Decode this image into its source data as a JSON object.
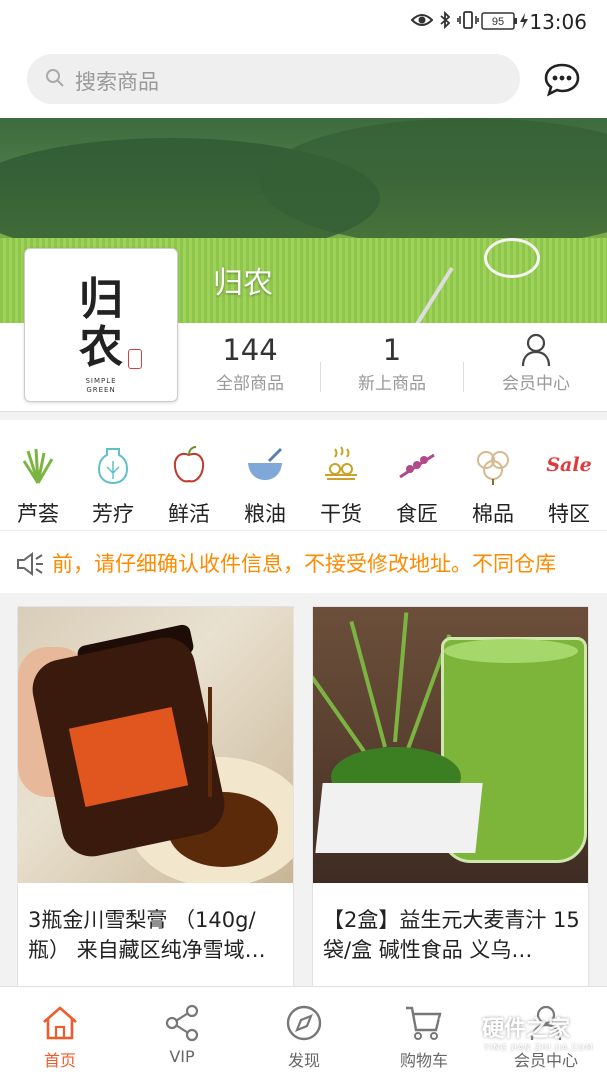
{
  "status_bar": {
    "battery": "95",
    "time": "13:06"
  },
  "search": {
    "placeholder": "搜索商品"
  },
  "store": {
    "name": "归农",
    "logo_text": [
      "归",
      "农"
    ],
    "logo_sub": [
      "SIMPLE",
      "GREEN"
    ],
    "stats": [
      {
        "value": "144",
        "label": "全部商品"
      },
      {
        "value": "1",
        "label": "新上商品"
      },
      {
        "value": "",
        "label": "会员中心"
      }
    ]
  },
  "categories": [
    {
      "label": "芦荟",
      "icon": "aloe-icon"
    },
    {
      "label": "芳疗",
      "icon": "aroma-icon"
    },
    {
      "label": "鲜活",
      "icon": "fresh-icon"
    },
    {
      "label": "粮油",
      "icon": "grain-oil-icon"
    },
    {
      "label": "干货",
      "icon": "dried-goods-icon"
    },
    {
      "label": "食匠",
      "icon": "food-craft-icon"
    },
    {
      "label": "棉品",
      "icon": "cotton-icon"
    },
    {
      "label": "特区",
      "icon": "sale-icon",
      "icon_text": "Sale"
    }
  ],
  "notice": {
    "text": "前，请仔细确认收件信息，不接受修改地址。不同仓库"
  },
  "products": [
    {
      "title": "3瓶金川雪梨膏 （140g/瓶） 来自藏区纯净雪域…"
    },
    {
      "title": "【2盒】益生元大麦青汁 15袋/盒 碱性食品 义乌…"
    }
  ],
  "bottom_nav": [
    {
      "label": "首页",
      "icon": "home-icon",
      "active": true
    },
    {
      "label": "VIP",
      "icon": "share-icon",
      "active": false
    },
    {
      "label": "发现",
      "icon": "compass-icon",
      "active": false
    },
    {
      "label": "购物车",
      "icon": "cart-icon",
      "active": false
    },
    {
      "label": "会员中心",
      "icon": "user-icon",
      "active": false
    }
  ],
  "watermark": {
    "text": "硬件之家",
    "sub": "YING JIAN ZHI JIA.COM"
  },
  "colors": {
    "accent": "#ef5b2a",
    "notice": "#ff8a00"
  }
}
